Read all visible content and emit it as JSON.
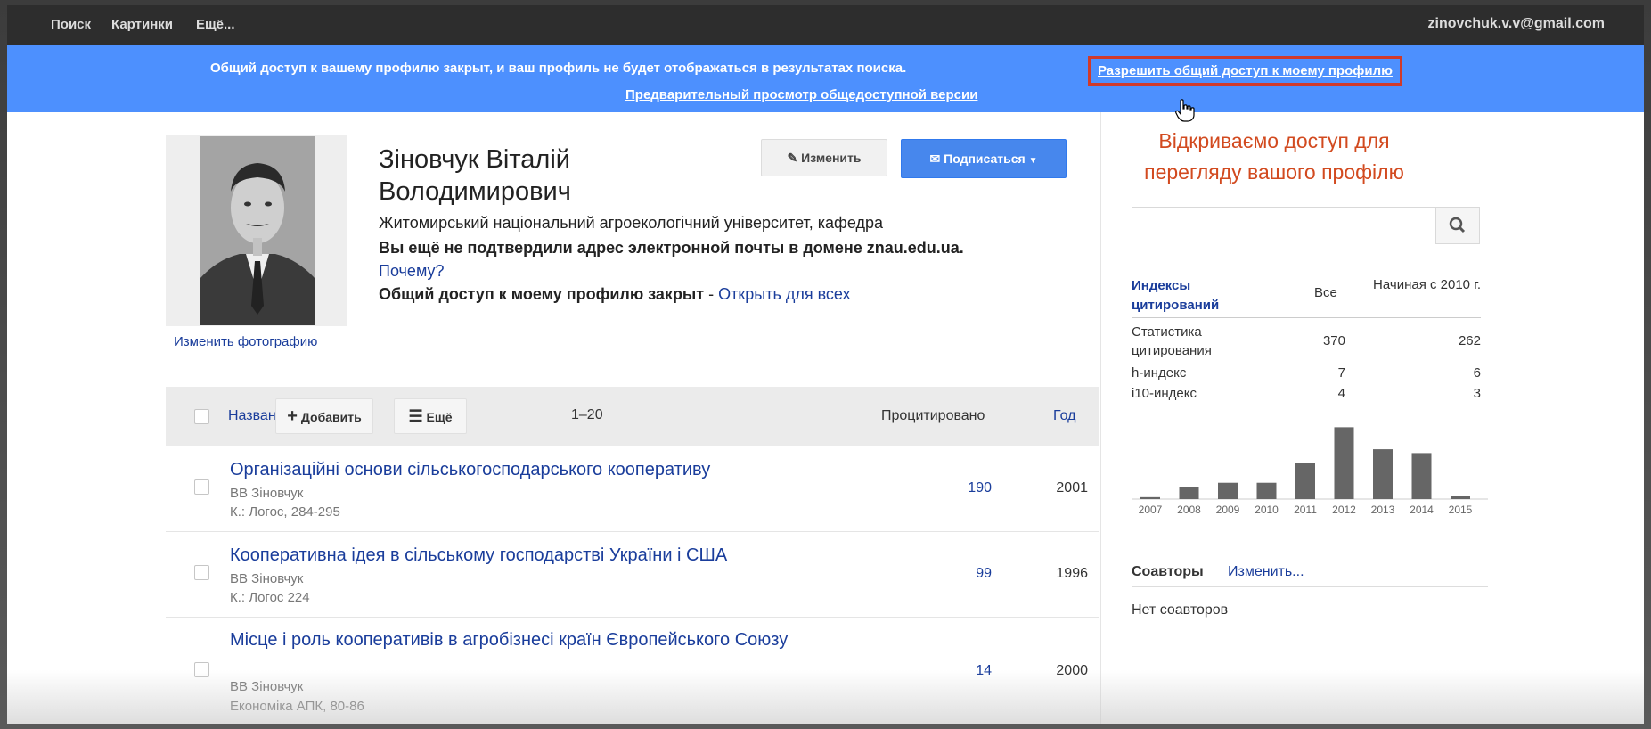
{
  "topbar": {
    "links": [
      "Поиск",
      "Картинки",
      "Ещё..."
    ],
    "account": "zinovchuk.v.v@gmail.com"
  },
  "banner": {
    "message": "Общий доступ к вашему профилю закрыт, и ваш профиль не будет отображаться в результатах поиска.",
    "allow_link": "Разрешить общий доступ к моему профилю",
    "preview_link": "Предварительный просмотр общедоступной версии"
  },
  "profile": {
    "name": "Зіновчук Віталій Володимирович",
    "affiliation": "Житомирський національний агроекологічний університет, кафедра",
    "email_warning": "Вы ещё не подтвердили адрес электронной почты в домене znau.edu.ua.",
    "why_link": "Почему?",
    "closed_text": "Общий доступ к моему профилю закрыт",
    "closed_sep": " - ",
    "open_link": "Открыть для всех",
    "change_photo": "Изменить фотографию",
    "edit_button": "Изменить",
    "subscribe_button": "Подписаться"
  },
  "table": {
    "col_title": "Название",
    "add_button": "Добавить",
    "more_button": "Ещё",
    "range": "1–20",
    "col_cited": "Процитировано",
    "col_year": "Год",
    "rows": [
      {
        "title": "Організаційні основи сільськогосподарського кооперативу",
        "authors": "ВВ Зіновчук",
        "source": "К.: Логос, 284-295",
        "cited": "190",
        "year": "2001"
      },
      {
        "title": "Кооперативна ідея в сільському господарстві України і США",
        "authors": "ВВ Зіновчук",
        "source": "К.: Логос 224",
        "cited": "99",
        "year": "1996"
      },
      {
        "title": "Місце і роль кооперативів в агробізнесі країн Європейського Союзу",
        "authors": "ВВ Зіновчук",
        "source": "Економіка АПК, 80-86",
        "cited": "14",
        "year": "2000"
      }
    ]
  },
  "annotation": "Відкриваємо доступ для перегляду вашого профілю",
  "citations": {
    "header_label": "Индексы цитирований",
    "header_all": "Все",
    "header_since": "Начиная с 2010 г.",
    "rows": [
      {
        "label": "Статистика цитирования",
        "all": "370",
        "since": "262"
      },
      {
        "label": "h-индекс",
        "all": "7",
        "since": "6"
      },
      {
        "label": "i10-индекс",
        "all": "4",
        "since": "3"
      }
    ]
  },
  "chart_data": {
    "type": "bar",
    "categories": [
      "2007",
      "2008",
      "2009",
      "2010",
      "2011",
      "2012",
      "2013",
      "2014",
      "2015"
    ],
    "values": [
      2,
      13,
      17,
      17,
      38,
      75,
      52,
      48,
      3
    ]
  },
  "coauthors": {
    "title": "Соавторы",
    "edit": "Изменить...",
    "empty": "Нет соавторов"
  },
  "colors": {
    "banner": "#4d90fe",
    "link": "#1a3d9b",
    "annotation": "#d24a1f",
    "highlight_box": "#d03a2a",
    "bar": "#666666"
  }
}
